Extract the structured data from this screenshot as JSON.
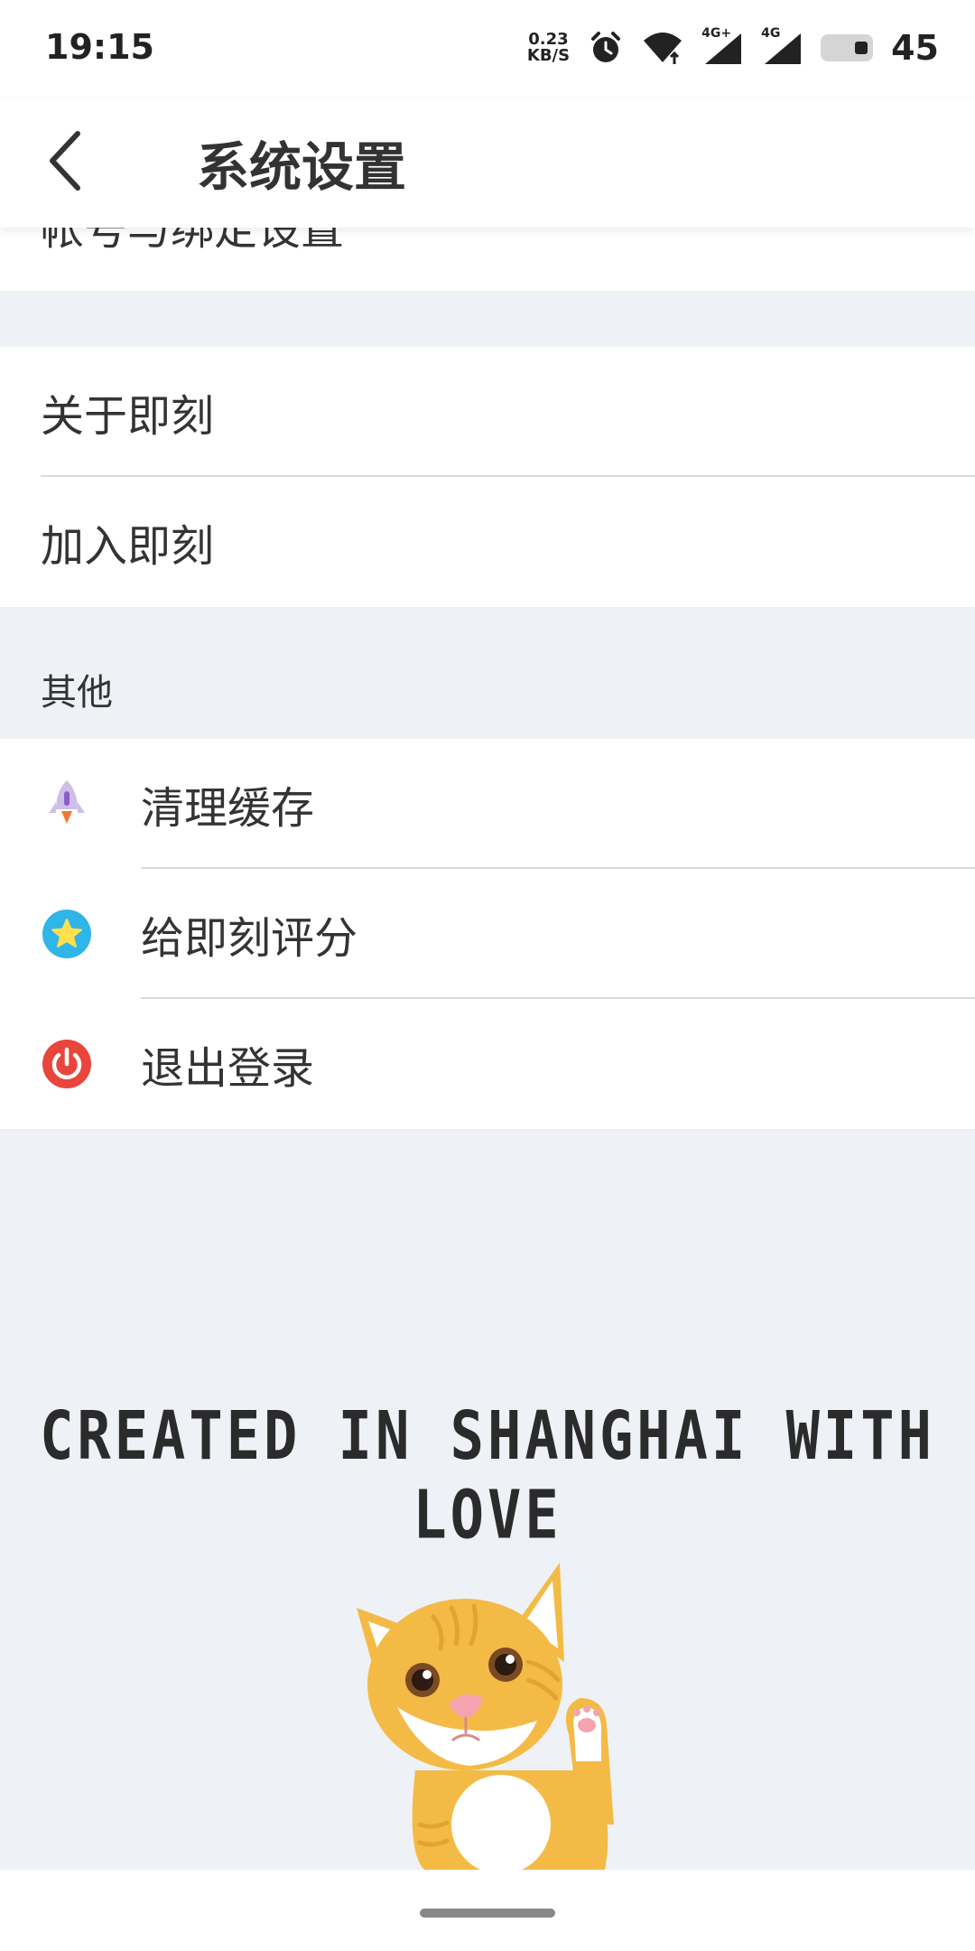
{
  "status_bar": {
    "time": "19:15",
    "net_speed_value": "0.23",
    "net_speed_unit": "KB/S",
    "signal1_label": "4G+",
    "signal2_label": "4G",
    "battery_level": "45",
    "icons": [
      "alarm-icon",
      "wifi-icon",
      "signal-icon",
      "signal-icon",
      "battery-icon"
    ]
  },
  "header": {
    "title": "系统设置",
    "back_icon": "chevron-left-icon"
  },
  "partial_row_label": "帐号与绑定设置",
  "group_about": {
    "items": [
      {
        "label": "关于即刻"
      },
      {
        "label": "加入即刻"
      }
    ]
  },
  "section_other": {
    "title": "其他",
    "items": [
      {
        "label": "清理缓存",
        "icon": "rocket-icon",
        "color": "#9b7fd1"
      },
      {
        "label": "给即刻评分",
        "icon": "star-icon",
        "color": "#2fb5e8"
      },
      {
        "label": "退出登录",
        "icon": "power-icon",
        "color": "#e8453c"
      }
    ]
  },
  "footer": {
    "tagline": "CREATED IN SHANGHAI WITH LOVE",
    "illustration": "cat-illustration"
  }
}
